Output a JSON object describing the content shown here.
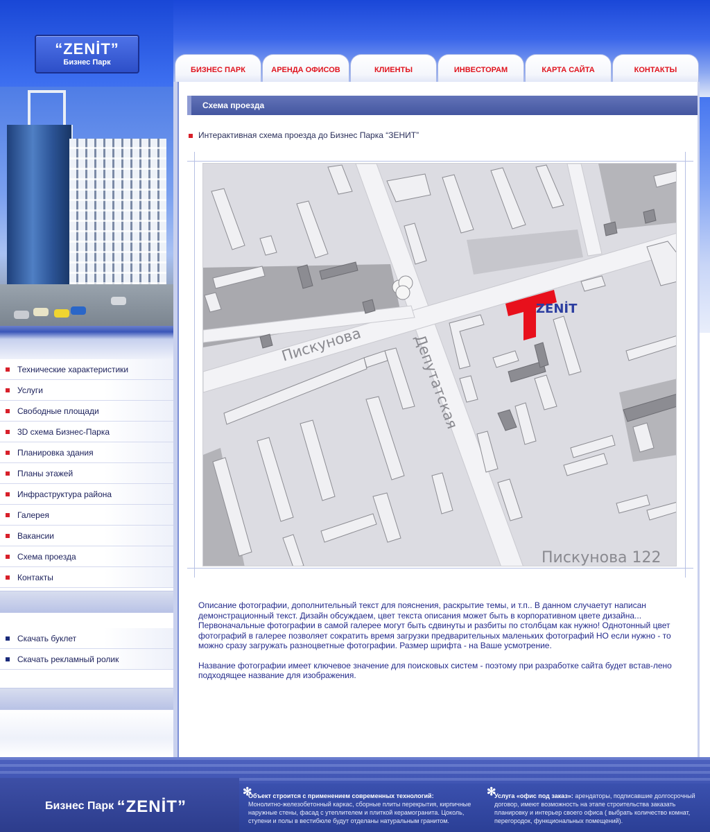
{
  "logo": {
    "brand": "“ZENİT”",
    "sub": "Бизнес Парк"
  },
  "tabs": [
    "БИЗНЕС ПАРК",
    "АРЕНДА ОФИСОВ",
    "КЛИЕНТЫ",
    "ИНВЕСТОРАМ",
    "КАРТА САЙТА",
    "КОНТАКТЫ"
  ],
  "sidebar": {
    "menu": [
      "Технические характеристики",
      "Услуги",
      "Свободные площади",
      "3D схема Бизнес-Парка",
      "Планировка здания",
      "Планы этажей",
      "Инфраструктура района",
      "Галерея",
      "Вакансии",
      "Схема проезда",
      "Контакты"
    ],
    "downloads": [
      "Скачать буклет",
      "Скачать рекламный ролик"
    ]
  },
  "content": {
    "section_title": "Схема проезда",
    "intro": "Интерактивная схема проезда до Бизнес Парка “ЗЕНИТ”",
    "description": [
      "Описание фотографии, дополнительный текст для пояснения, раскрытие темы, и т.п.. В данном случаетут написан демонстрационный текст. Дизайн обсуждаем, цвет текста описания может быть в корпоративном цвете дизайна... Первоначальные фотографии в самой галерее могут быть сдвинуты и разбиты по столбцам как нужно! Однотонный цвет фотографий в галерее позволяет сократить время загрузки предварительных маленьких фотографий НО если нужно - то можно сразу загружать разноцветные фотографии. Размер шрифта - на Ваше усмотрение.",
      "Название фотографии имеет ключевое значение для поисковых систем - поэтому при разработке сайта будет встав-лено подходящее название для изображения."
    ]
  },
  "map": {
    "street_1": "Пискунова",
    "street_2": "Депутатская",
    "address": "Пискунова 122",
    "marker_label": "ZENİT",
    "colors": {
      "marker": "#e8101c",
      "block": "#d8d8dc",
      "building": "#ececf0",
      "dark_building": "#8a8a90",
      "road": "#f4f4f6"
    }
  },
  "footer": {
    "brand_prefix": "Бизнес Парк",
    "brand_name": "“ZENİT”",
    "note1_title": "Объект строится с применением современных технологий:",
    "note1_body": "Монолитно-железобетонный каркас, сборные плиты перекрытия, кирпичные наружные стены, фасад с утеплителем и плиткой керамогранита. Цоколь, ступени и полы в вестибюле будут отделаны натуральным гранитом.",
    "note2_title": "Услуга «офис под заказ»:",
    "note2_body": "арендаторы, подписавшие долгосрочный договор, имеют возможность на этапе строительства заказать планировку и интерьер своего офиса ( выбрать количество комнат, перегородок, функциональных помещений)."
  }
}
